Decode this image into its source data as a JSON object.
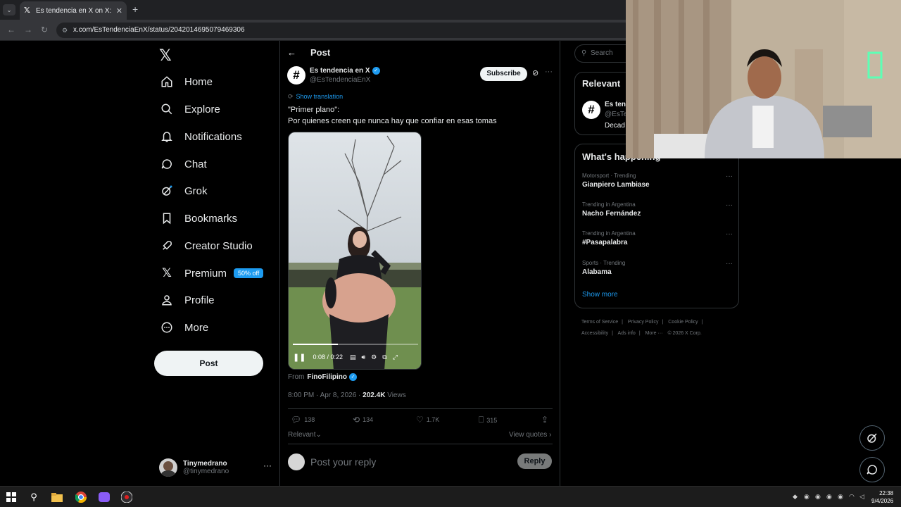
{
  "browser": {
    "tab_title": "Es tendencia en X on X: \"\"Prime",
    "tab_close": "✕",
    "new_tab": "+",
    "url": "x.com/EsTendenciaEnX/status/2042014695079469306"
  },
  "nav": {
    "logo": "X",
    "items": [
      {
        "label": "Home",
        "icon": "home-icon"
      },
      {
        "label": "Explore",
        "icon": "search-icon"
      },
      {
        "label": "Notifications",
        "icon": "bell-icon"
      },
      {
        "label": "Chat",
        "icon": "chat-icon"
      },
      {
        "label": "Grok",
        "icon": "grok-icon"
      },
      {
        "label": "Bookmarks",
        "icon": "bookmark-icon"
      },
      {
        "label": "Creator Studio",
        "icon": "rocket-icon"
      },
      {
        "label": "Premium",
        "icon": "x-icon",
        "badge": "50% off"
      },
      {
        "label": "Profile",
        "icon": "person-icon"
      },
      {
        "label": "More",
        "icon": "more-icon"
      }
    ],
    "post_button": "Post",
    "account": {
      "name": "Tinymedrano",
      "handle": "@tinymedrano",
      "more": "···"
    }
  },
  "post": {
    "header_title": "Post",
    "author_name": "Es tendencia en X",
    "author_handle": "@EsTendenciaEnX",
    "subscribe_label": "Subscribe",
    "more": "···",
    "show_translation": "Show translation",
    "text_line1": "\"Primer plano\":",
    "text_line2": "Por quienes creen que nunca hay que confiar en esas tomas",
    "video": {
      "time": "0:08 / 0:22",
      "progress": 0.36
    },
    "from_label": "From",
    "from_name": "FinoFilipino",
    "timestamp": "8:00 PM · Apr 8, 2026 · ",
    "views_count": "202.4K",
    "views_label": " Views",
    "stats": {
      "replies": "138",
      "reposts": "134",
      "likes": "1.7K",
      "bookmarks": "315"
    },
    "sort_label": "Relevant",
    "view_quotes": "View quotes",
    "reply_placeholder": "Post your reply",
    "reply_button": "Reply"
  },
  "sidebar": {
    "search_placeholder": "Search",
    "relevant_title": "Relevant",
    "relevant_name": "Es ten",
    "relevant_handle": "@EsTe",
    "relevant_bio": "Decad",
    "happening_title": "What's happening",
    "trends": [
      {
        "context": "Motorsport · Trending",
        "title": "Gianpiero Lambiase"
      },
      {
        "context": "Trending in Argentina",
        "title": "Nacho Fernández"
      },
      {
        "context": "Trending in Argentina",
        "title": "#Pasapalabra"
      },
      {
        "context": "Sports · Trending",
        "title": "Alabama"
      }
    ],
    "show_more": "Show more",
    "footer": [
      "Terms of Service",
      "|",
      "Privacy Policy",
      "|",
      "Cookie Policy",
      "|",
      "Accessibility",
      "|",
      "Ads info",
      "|",
      "More ···",
      "© 2026 X Corp."
    ]
  },
  "taskbar": {
    "time": "22:38",
    "date": "9/4/2026"
  },
  "colors": {
    "accent": "#1d9bf0",
    "background": "#000000",
    "border": "#2f3336",
    "muted": "#71767b"
  }
}
